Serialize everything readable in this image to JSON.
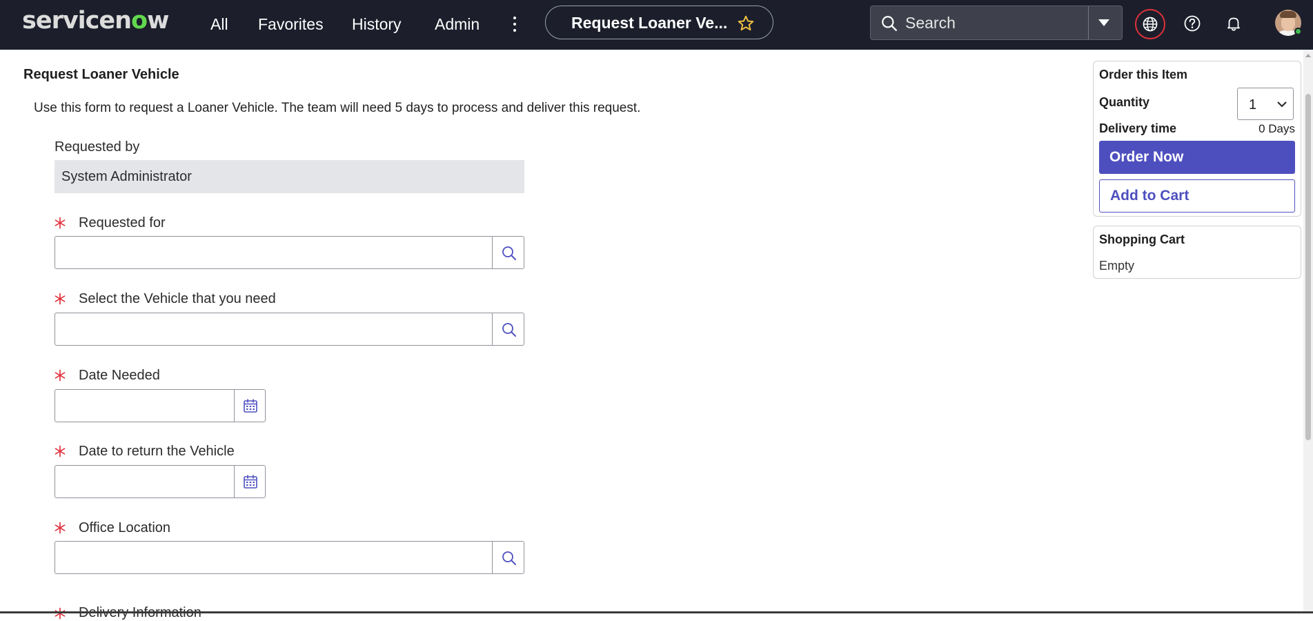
{
  "header": {
    "logo_text": "servicenow",
    "nav": [
      "All",
      "Favorites",
      "History",
      "Admin"
    ],
    "page_title": "Request Loaner Ve...",
    "search_placeholder": "Search",
    "icons": [
      "search-icon",
      "chevron-down-icon",
      "globe-icon",
      "help-icon",
      "bell-icon",
      "avatar"
    ]
  },
  "form": {
    "title": "Request Loaner Vehicle",
    "intro": "Use this form to request a Loaner Vehicle. The team will need 5 days to process and deliver this request.",
    "requested_by": {
      "label": "Requested by",
      "value": "System Administrator"
    },
    "requested_for": {
      "label": "Requested for",
      "value": ""
    },
    "vehicle": {
      "label": "Select the Vehicle that you need",
      "value": ""
    },
    "date_needed": {
      "label": "Date Needed",
      "value": ""
    },
    "date_return": {
      "label": "Date to return the Vehicle",
      "value": ""
    },
    "office_location": {
      "label": "Office Location",
      "value": ""
    },
    "delivery_info": {
      "label": "Delivery Information"
    }
  },
  "order": {
    "title": "Order this Item",
    "quantity_label": "Quantity",
    "quantity_value": "1",
    "delivery_label": "Delivery time",
    "delivery_value": "0 Days",
    "order_now": "Order Now",
    "add_to_cart": "Add to Cart"
  },
  "cart": {
    "title": "Shopping Cart",
    "status": "Empty"
  },
  "colors": {
    "header_bg": "#1c1f2b",
    "primary": "#4d4fbf",
    "required": "#e0323c",
    "logo_accent": "#62d84e",
    "readonly_bg": "#e4e5e9"
  }
}
